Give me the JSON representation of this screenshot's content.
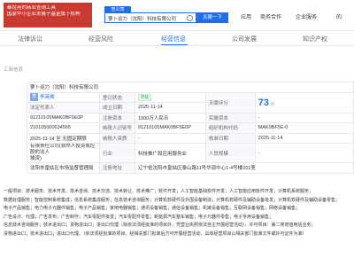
{
  "banner": {
    "lines": [
      "都在用的商业查询工具",
      "国家中小企业发展子基金旗下机构"
    ]
  },
  "search": {
    "tab_label": "查公司",
    "query": "萝卜运力（沈阳）科技有限公司",
    "button": "天眼一下"
  },
  "header_nav": [
    "应用",
    "商务合作",
    "企业服务",
    "的"
  ],
  "tabs": [
    {
      "label": "法律诉讼"
    },
    {
      "label": "经营风险"
    },
    {
      "label": "经营信息"
    },
    {
      "label": "公司发展"
    },
    {
      "label": "知识产权"
    }
  ],
  "section_title": "工商信息",
  "info": {
    "company_name": "萝卜运力（沈阳）科技有限公司",
    "legal_rep_label": "法定代表人",
    "legal_rep_avatar": "李",
    "legal_rep_name": "李英卿",
    "reg_status_label": "登记状态",
    "reg_status_value": "存续",
    "founded_label": "成立日期",
    "founded_value": "2025-11-14",
    "score_label": "天眼评分",
    "score_value": "73",
    "score_unit": "分",
    "uscc_value": "91210105MAK0BF5E0P",
    "reg_capital_label": "注册资本",
    "reg_capital_value": "1000万人民币",
    "paid_capital_label": "实缴资本",
    "paid_capital_value": "-",
    "reg_no_value": "210105000634565",
    "taxpayer_id_label": "纳税人识别号",
    "taxpayer_id_value": "91210105MAK0BF5E0P",
    "org_code_label": "组织机构代码",
    "org_code_value": "MAK0BF5E-0",
    "term_value": "2025-11-14 至 无固定期限",
    "taxpayer_qual_label": "纳税人资质",
    "taxpayer_qual_value": "-",
    "approval_label": "核准日期",
    "approval_value": "2025-11-14",
    "company_type_line1": "有限责任公司(自然人投资或控股的法人",
    "company_type_line2": "独资)",
    "industry_label": "行业",
    "industry_value": "科技推广和应用服务业",
    "staff_label": "人员规模",
    "staff_value": "-",
    "authority_value": "沈阳市皇姑区市场监督管理局",
    "address_label": "注册地址",
    "address_value": "辽宁省沈阳市皇姑区泰山路11号华润中心1-4号楼201室"
  },
  "scope": {
    "lines": [
      "一般项目：技术服务、技术开发、技术咨询、技术交流、技术转让、技术推广；软件开发；人工智能基础软件开发；人工智能应用软件开发；计算机系统服务；",
      "数据处理服务；智能控制系统集成；信息系统集成服务；信息技术咨询服务；计算机软硬件及外围设备制造；计算机软硬件及辅助设备批发；计算机软硬件及辅助设备零售；",
      "电子产品销售；电力电子元器件销售；电子产品销售；家用电器销售；通讯设备销售；通信设备销售；机械设备销售；互联网设备销售；网络设备销售；",
      "广告设计、代理；广告发布；广告制作；汽车零配件批发；汽车零配件零售；新能源汽车整车销售；电子元器件零售；电子专用设备销售；",
      "信息技术咨询服务；技术进出口；货物进出口；进出口代理（除依法须经批准的项目外，凭营业执照依法自主开展经营活动）。许可项目：第二类增值电信业务；",
      "货物进出口；技术进出口；进出口代理。（依法须经批准的项目，经相关部门批准后方可开展经营活动，具体经营项目以相关部门批准文件或许可证件为准）"
    ]
  }
}
